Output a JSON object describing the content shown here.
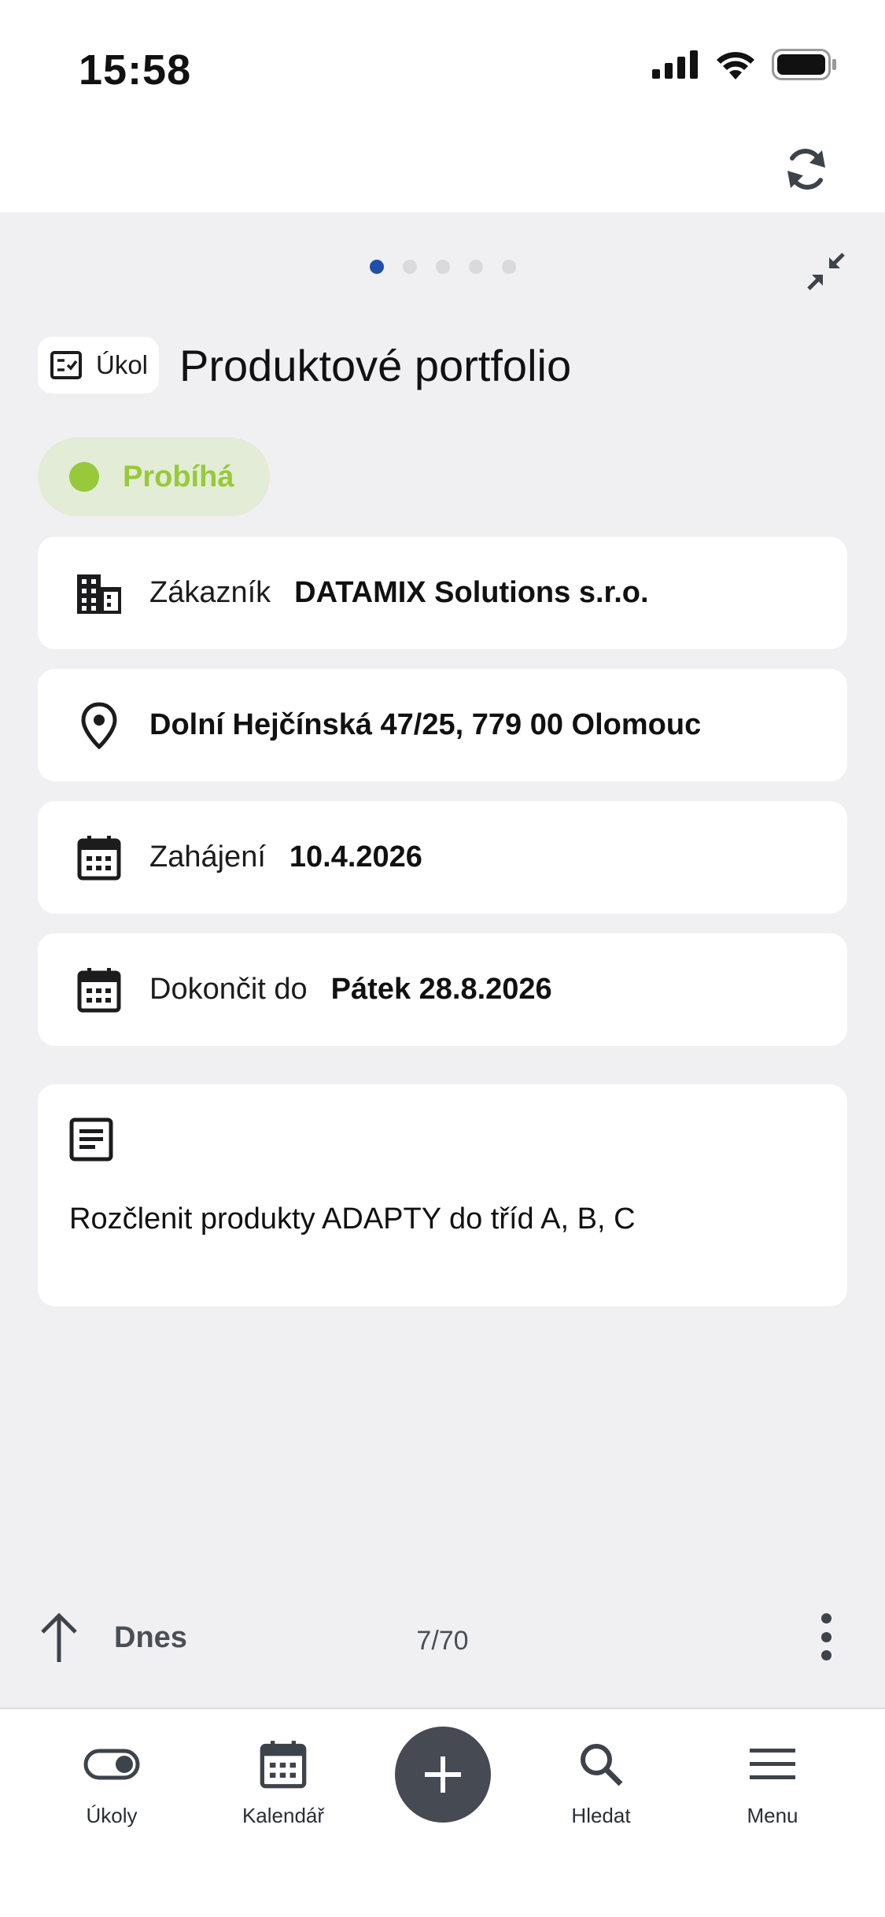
{
  "status_bar": {
    "time": "15:58"
  },
  "pager": {
    "total_dots": 5,
    "active_index": 0
  },
  "task": {
    "type_label": "Úkol",
    "title": "Produktové portfolio",
    "status": "Probíhá",
    "status_color": "#97c93a"
  },
  "details": {
    "customer_label": "Zákazník",
    "customer_value": "DATAMIX Solutions s.r.o.",
    "address": "Dolní Hejčínská 47/25, 779 00 Olomouc",
    "start_label": "Zahájení",
    "start_value": "10.4.2026",
    "due_label": "Dokončit do",
    "due_value": "Pátek 28.8.2026",
    "note": "Rozčlenit produkty ADAPTY do tříd A, B, C"
  },
  "footer": {
    "today_label": "Dnes",
    "counter": "7/70"
  },
  "tabbar": {
    "tasks": "Úkoly",
    "calendar": "Kalendář",
    "search": "Hledat",
    "menu": "Menu"
  },
  "colors": {
    "accent": "#1f4fa8",
    "fab": "#454a53",
    "background": "#f0f0f2"
  }
}
